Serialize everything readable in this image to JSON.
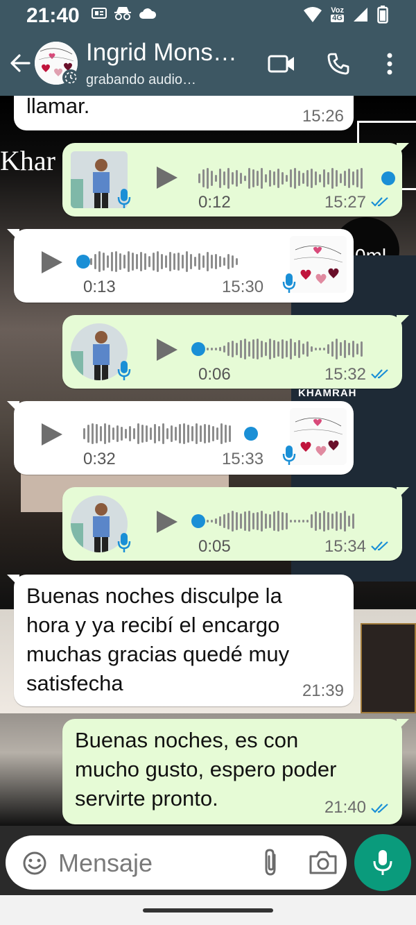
{
  "status_bar": {
    "time": "21:40",
    "network_label_top": "Voz",
    "network_label_bottom": "4G",
    "icons": [
      "sim-icon",
      "incognito-icon",
      "cloud-icon",
      "wifi-icon",
      "signal-icon",
      "battery-icon"
    ]
  },
  "header": {
    "contact_name": "Ingrid Mons…",
    "status": "grabando audio…",
    "icons": [
      "back-arrow-icon",
      "video-call-icon",
      "phone-icon",
      "more-vert-icon"
    ]
  },
  "background": {
    "deco_left": "Khar",
    "deco_right": "0ml",
    "deco_box": "KHAMRAH"
  },
  "messages": [
    {
      "type": "text",
      "dir": "in",
      "text": "llamar.",
      "time": "15:26"
    },
    {
      "type": "voice",
      "dir": "out",
      "duration": "0:12",
      "time": "15:27",
      "progress": 1.0,
      "read": true
    },
    {
      "type": "voice",
      "dir": "in",
      "duration": "0:13",
      "time": "15:30",
      "progress": 0.0
    },
    {
      "type": "voice",
      "dir": "out",
      "duration": "0:06",
      "time": "15:32",
      "progress": 0.0,
      "read": true
    },
    {
      "type": "voice",
      "dir": "in",
      "duration": "0:32",
      "time": "15:33",
      "progress": 1.0
    },
    {
      "type": "voice",
      "dir": "out",
      "duration": "0:05",
      "time": "15:34",
      "progress": 0.0,
      "read": true
    },
    {
      "type": "text",
      "dir": "in",
      "lines": [
        "Buenas noches disculpe la",
        "hora y ya recibí el encargo",
        "muchas gracias quedé muy",
        "satisfecha"
      ],
      "time": "21:39"
    },
    {
      "type": "text",
      "dir": "out",
      "lines": [
        "Buenas noches, es con",
        "mucho gusto, espero poder",
        "servirte pronto."
      ],
      "time": "21:40",
      "read": true
    }
  ],
  "composer": {
    "placeholder": "Mensaje",
    "icons": [
      "emoji-icon",
      "attach-icon",
      "camera-icon",
      "mic-icon"
    ]
  },
  "colors": {
    "header": "#3d5763",
    "incoming_bubble": "#ffffff",
    "outgoing_bubble": "#e6fbd6",
    "accent_blue": "#1a8fd6",
    "mic_fab": "#0a9b7c"
  }
}
